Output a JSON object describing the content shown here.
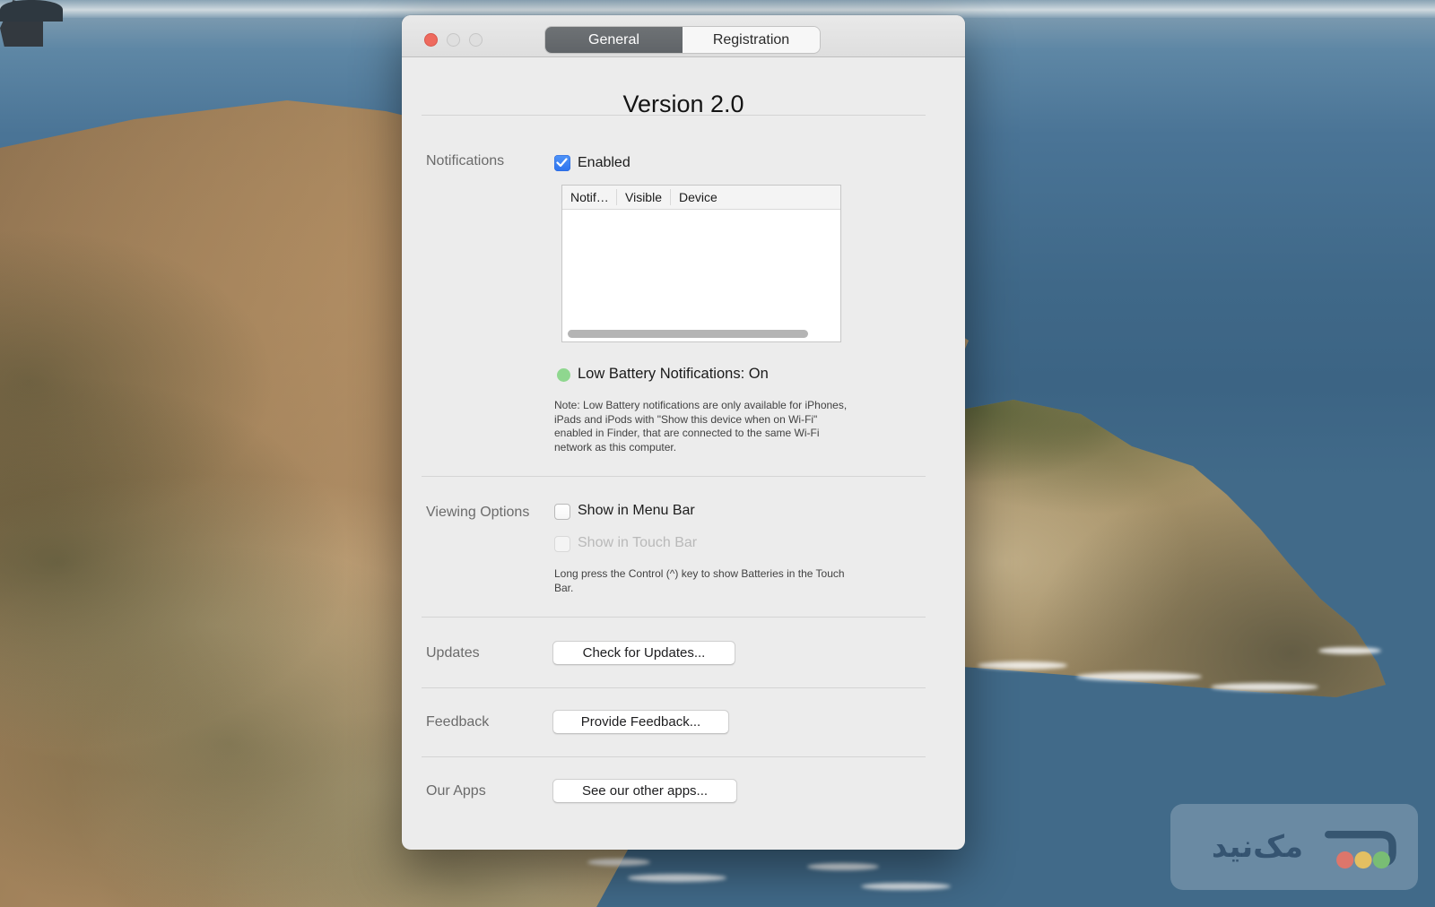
{
  "window": {
    "tabs": [
      {
        "label": "General",
        "selected": true
      },
      {
        "label": "Registration",
        "selected": false
      }
    ],
    "version_title": "Version 2.0",
    "notifications": {
      "label": "Notifications",
      "enabled_checkbox": "Enabled",
      "table": {
        "columns": [
          "Notif…",
          "Visible",
          "Device"
        ],
        "rows": []
      },
      "status": "Low Battery Notifications: On",
      "note": "Note: Low Battery notifications are only available for iPhones, iPads and iPods with \"Show this device when on Wi-Fi\" enabled in Finder, that are connected to the same Wi-Fi network as this computer."
    },
    "viewing_options": {
      "label": "Viewing Options",
      "menu_bar_checkbox": "Show in Menu Bar",
      "touch_bar_checkbox": "Show in Touch Bar",
      "note": "Long press the Control (^) key to show Batteries in the Touch Bar."
    },
    "updates": {
      "label": "Updates",
      "button": "Check for Updates..."
    },
    "feedback": {
      "label": "Feedback",
      "button": "Provide Feedback..."
    },
    "our_apps": {
      "label": "Our Apps",
      "button": "See our other apps..."
    }
  },
  "watermark": {
    "text": "مک‌نید"
  },
  "colors": {
    "checkbox_blue": "#3b7df2",
    "status_green": "#8fd78f",
    "traffic_red": "#ee6a5e",
    "selected_tab_gray": "#65696d",
    "watermark_red": "#dd766b",
    "watermark_yellow": "#e3bf62",
    "watermark_green": "#79bd74"
  }
}
